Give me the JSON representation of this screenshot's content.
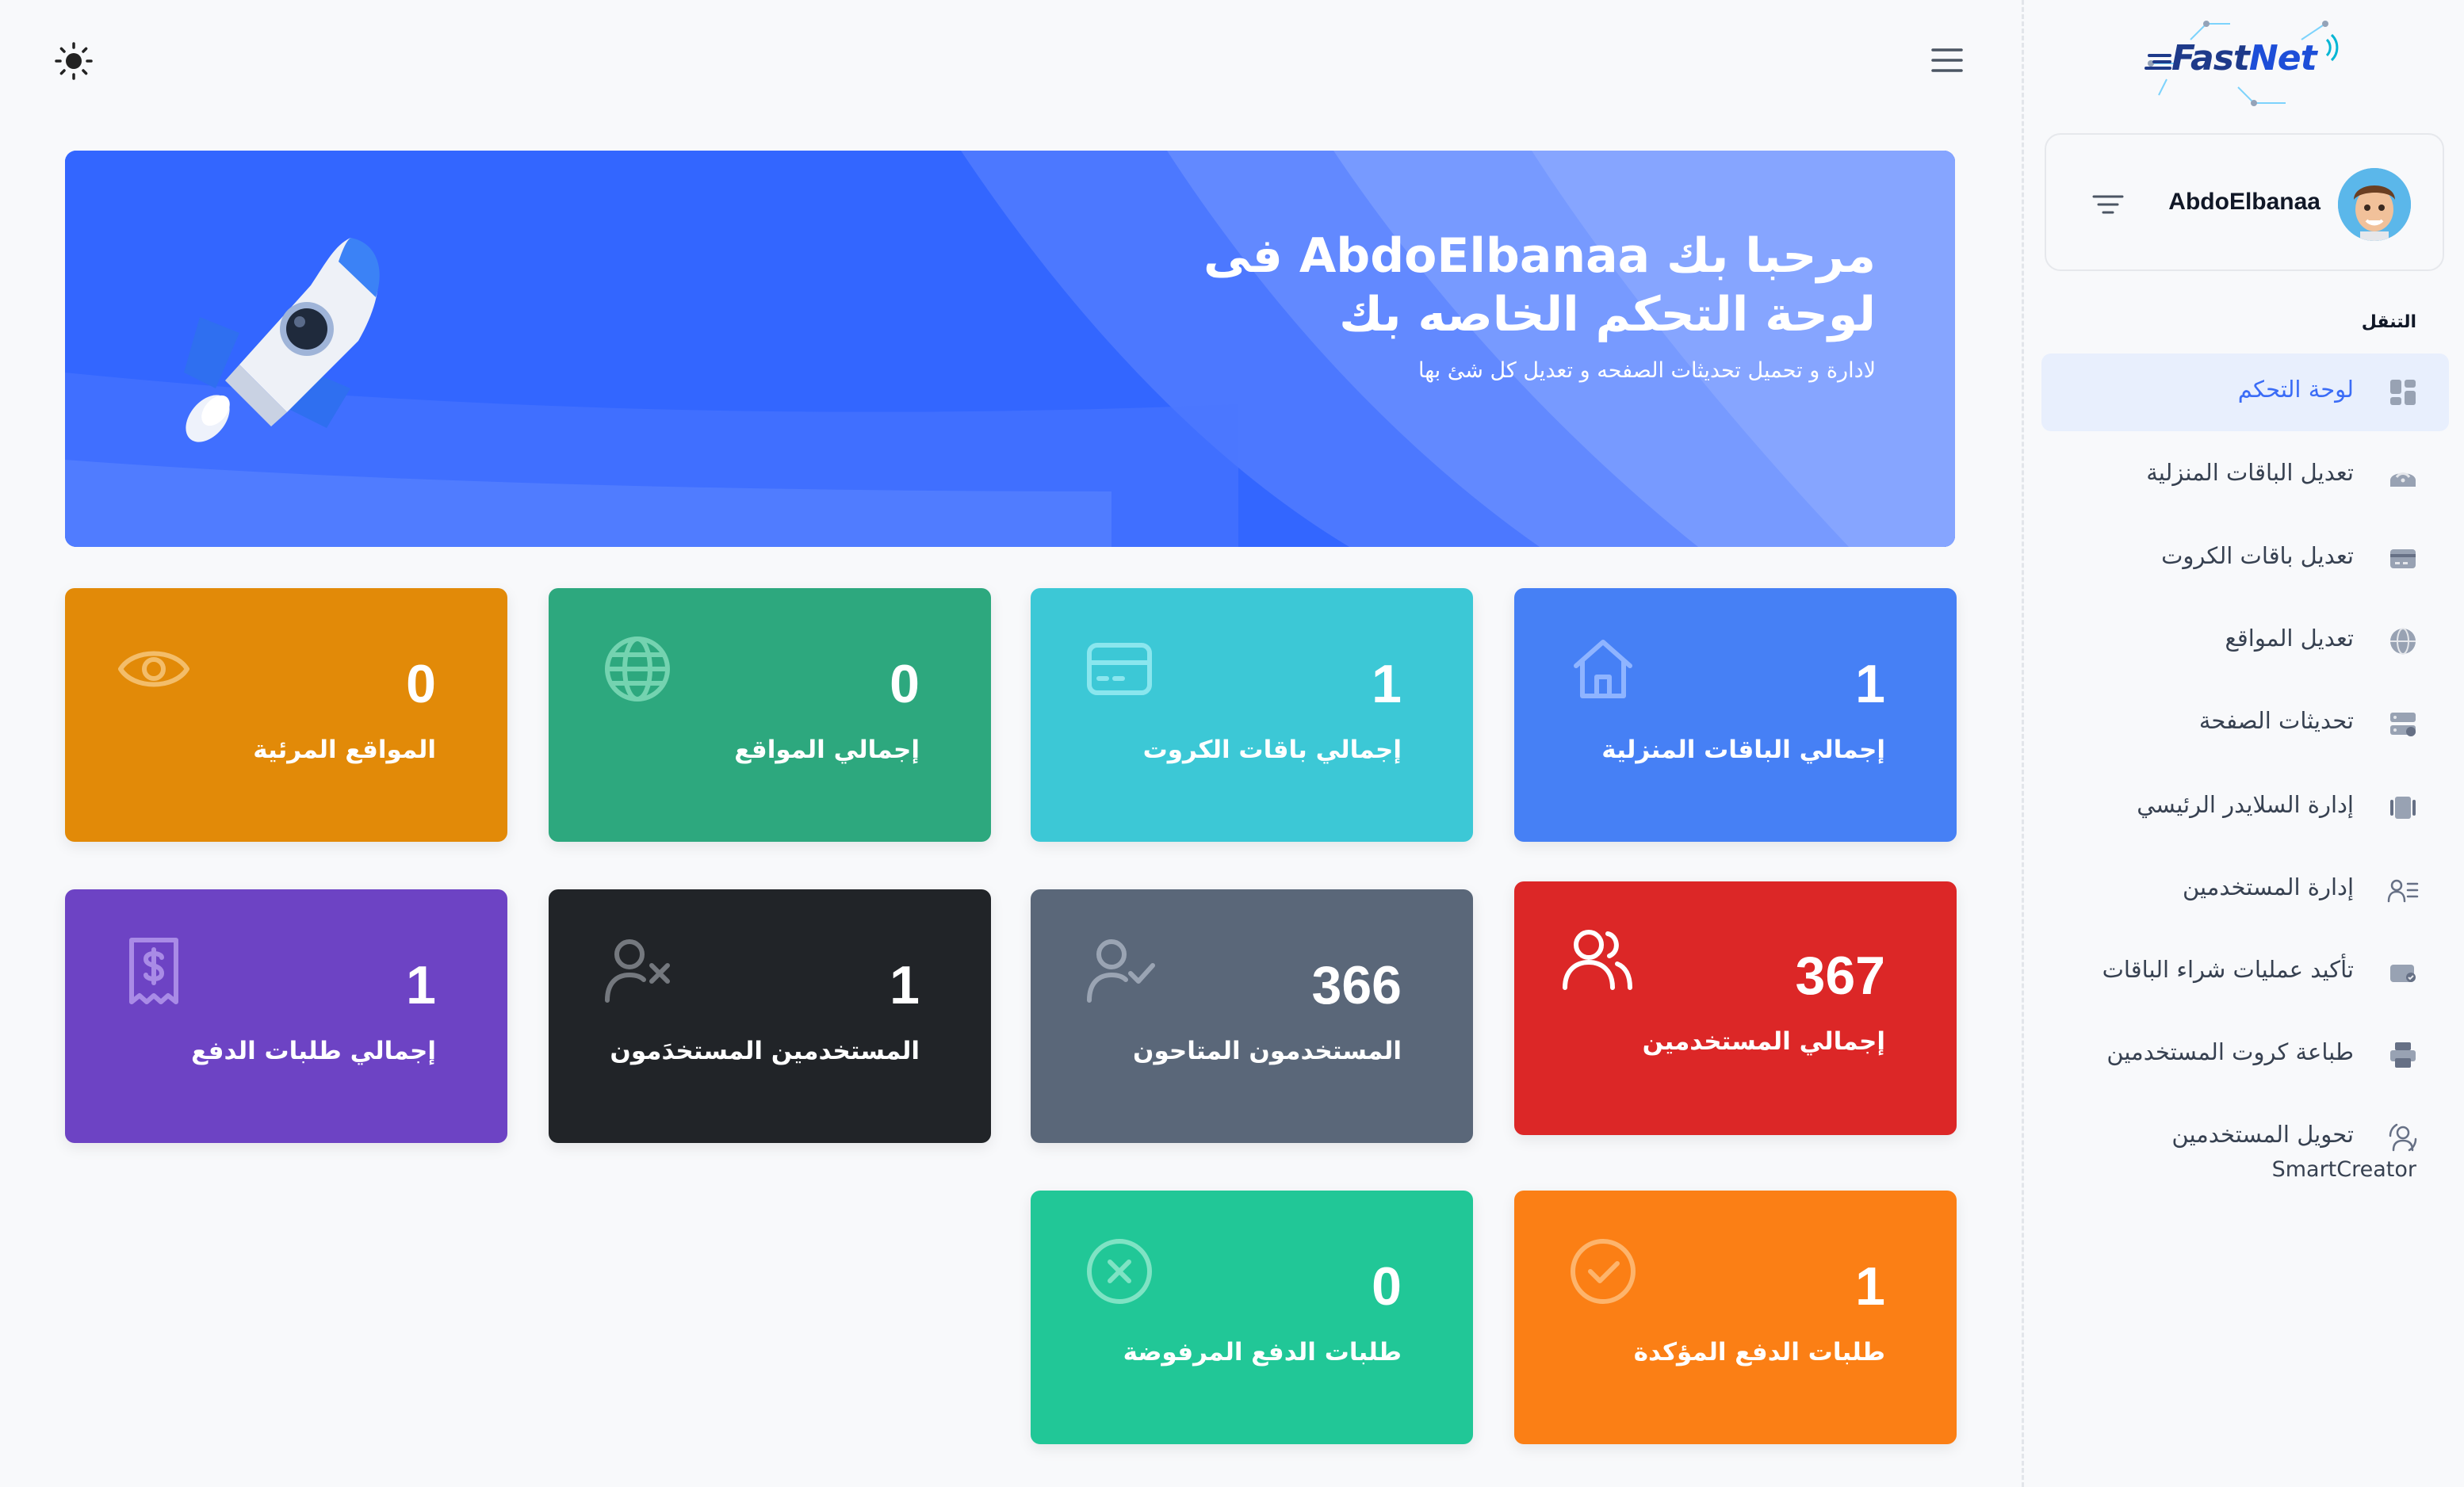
{
  "colors": {
    "accent": "#3b6cf6",
    "banner": "#3366ff",
    "card_home": "#4680f5",
    "card_cards": "#3cc8d6",
    "card_sites": "#2da87e",
    "card_visible": "#e28a08",
    "card_users": "#dc2727",
    "card_active": "#5a6779",
    "card_deleted": "#212428",
    "card_payments": "#6d43c4",
    "card_confirmed": "#fb7f15",
    "card_rejected": "#21c797"
  },
  "brand": {
    "logo_part1": "Fast",
    "logo_part2": "Net"
  },
  "user": {
    "name": "AbdoElbanaa"
  },
  "nav": {
    "heading": "التنقل",
    "items": [
      {
        "label": "لوحة التحكم",
        "icon": "dashboard-icon",
        "active": true
      },
      {
        "label": "تعديل الباقات المنزلية",
        "icon": "router-icon"
      },
      {
        "label": "تعديل باقات الكروت",
        "icon": "card-icon"
      },
      {
        "label": "تعديل المواقع",
        "icon": "globe-icon"
      },
      {
        "label": "تحديثات الصفحة",
        "icon": "server-icon"
      },
      {
        "label": "إدارة السلايدر الرئيسي",
        "icon": "slider-icon"
      },
      {
        "label": "إدارة المستخدمين",
        "icon": "user-list-icon"
      },
      {
        "label": "تأكيد عمليات شراء الباقات",
        "icon": "wallet-icon"
      },
      {
        "label": "طباعة كروت المستخدمين",
        "icon": "printer-icon"
      },
      {
        "label": "تحويل المستخدمين",
        "icon": "user-transfer-icon",
        "sub": "SmartCreator"
      }
    ]
  },
  "banner": {
    "title": "مرحبا بك AbdoElbanaa فى لوحة التحكم الخاصه بك",
    "subtitle": "لادارة و تحميل تحديثات الصفحه و تعديل كل شئ بها"
  },
  "stats": {
    "home_packages": {
      "value": "1",
      "label": "إجمالي الباقات المنزلية",
      "icon": "home-icon"
    },
    "card_packages": {
      "value": "1",
      "label": "إجمالي باقات الكروت",
      "icon": "credit-card-icon"
    },
    "sites": {
      "value": "0",
      "label": "إجمالي المواقع",
      "icon": "globe-icon"
    },
    "visible_sites": {
      "value": "0",
      "label": "المواقع المرئية",
      "icon": "eye-icon"
    },
    "users": {
      "value": "367",
      "label": "إجمالي المستخدمين",
      "icon": "users-icon"
    },
    "available_users": {
      "value": "366",
      "label": "المستخدمون المتاحون",
      "icon": "user-check-icon"
    },
    "deleted_users": {
      "value": "1",
      "label": "المستخدمين المستخدَمون",
      "icon": "user-x-icon"
    },
    "payment_requests": {
      "value": "1",
      "label": "إجمالي طلبات الدفع",
      "icon": "receipt-icon"
    },
    "confirmed_payments": {
      "value": "1",
      "label": "طلبات الدفع المؤكدة",
      "icon": "check-circle-icon"
    },
    "rejected_payments": {
      "value": "0",
      "label": "طلبات الدفع المرفوضة",
      "icon": "x-circle-icon"
    }
  }
}
